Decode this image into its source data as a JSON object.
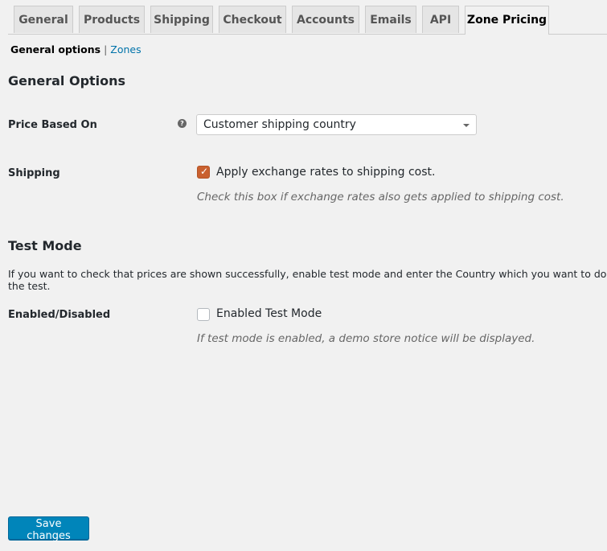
{
  "tabs": [
    "General",
    "Products",
    "Shipping",
    "Checkout",
    "Accounts",
    "Emails",
    "API",
    "Zone Pricing"
  ],
  "active_tab": "Zone Pricing",
  "subnav": {
    "current": "General options",
    "separator": "|",
    "link": "Zones"
  },
  "general": {
    "heading": "General Options",
    "price_label": "Price Based On",
    "help_icon": "question-icon",
    "price_value": "Customer shipping country",
    "shipping_label": "Shipping",
    "shipping_checkbox": "Apply exchange rates to shipping cost.",
    "shipping_checked": true,
    "shipping_desc": "Check this box if exchange rates also gets applied to shipping cost."
  },
  "test": {
    "heading": "Test Mode",
    "intro": "If you want to check that prices are shown successfully, enable test mode and enter the Country which you want to do the test.",
    "enabled_label": "Enabled/Disabled",
    "checkbox": "Enabled Test Mode",
    "checked": false,
    "desc": "If test mode is enabled, a demo store notice will be displayed."
  },
  "save_label": "Save changes",
  "colors": {
    "accent": "#0085ba",
    "checkbox": "#c9602f",
    "link": "#0073aa"
  }
}
